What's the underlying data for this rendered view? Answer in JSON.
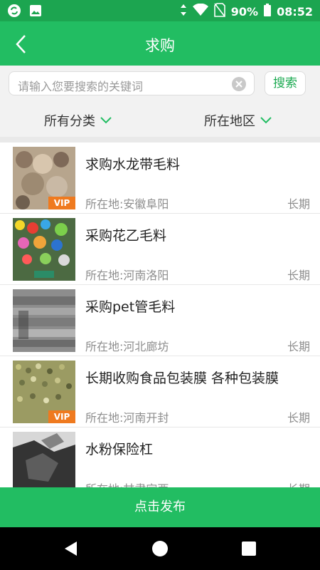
{
  "status_bar": {
    "battery": "90%",
    "time": "08:52",
    "left_icons": [
      "sync-icon",
      "image-icon"
    ],
    "right_icons": [
      "data-transfer-icon",
      "wifi-icon",
      "no-sim-icon",
      "battery-icon"
    ]
  },
  "header": {
    "title": "求购",
    "back_icon": "chevron-left-icon"
  },
  "search": {
    "placeholder": "请输入您要搜索的关键词",
    "button": "搜索"
  },
  "filters": {
    "category": "所有分类",
    "region": "所在地区"
  },
  "list": [
    {
      "title": "求购水龙带毛料",
      "location": "所在地:安徽阜阳",
      "term": "长期",
      "vip": "VIP"
    },
    {
      "title": "采购花乙毛料",
      "location": "所在地:河南洛阳",
      "term": "长期",
      "vip": ""
    },
    {
      "title": "采购pet管毛料",
      "location": "所在地:河北廊坊",
      "term": "长期",
      "vip": ""
    },
    {
      "title": "长期收购食品包装膜 各种包装膜",
      "location": "所在地:河南开封",
      "term": "长期",
      "vip": "VIP"
    },
    {
      "title": "水粉保险杠",
      "location": "所在地:甘肃定西",
      "term": "长期",
      "vip": ""
    }
  ],
  "bottom": {
    "publish": "点击发布"
  },
  "colors": {
    "primary": "#22bd62",
    "status_bar": "#1ca550",
    "vip": "#ef7a1f"
  }
}
